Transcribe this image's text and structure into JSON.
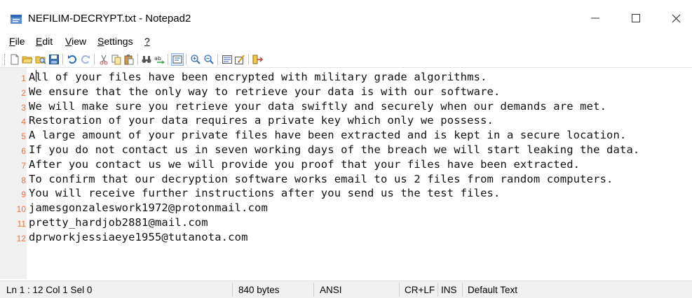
{
  "window": {
    "title": "NEFILIM-DECRYPT.txt - Notepad2",
    "minimize": "—",
    "maximize": "☐",
    "close": "✕"
  },
  "menu": [
    {
      "acc": "F",
      "rest": "ile"
    },
    {
      "acc": "E",
      "rest": "dit"
    },
    {
      "acc": "V",
      "rest": "iew"
    },
    {
      "acc": "S",
      "rest": "ettings"
    },
    {
      "acc": "?",
      "rest": ""
    }
  ],
  "toolbar": {
    "icons": [
      "new-file-icon",
      "open-file-icon",
      "browse-icon",
      "save-icon",
      "undo-icon",
      "redo-icon",
      "cut-icon",
      "copy-icon",
      "paste-icon",
      "find-icon",
      "replace-icon",
      "word-wrap-icon",
      "zoom-in-icon",
      "zoom-out-icon",
      "select-scheme-icon",
      "customize-scheme-icon",
      "exit-icon"
    ]
  },
  "editor": {
    "lines": [
      {
        "num": "1",
        "text": "All of your files have been encrypted with military grade algorithms."
      },
      {
        "num": "2",
        "text": "We ensure that the only way to retrieve your data is with our software."
      },
      {
        "num": "3",
        "text": "We will make sure you retrieve your data swiftly and securely when our demands are met."
      },
      {
        "num": "4",
        "text": "Restoration of your data requires a private key which only we possess."
      },
      {
        "num": "5",
        "text": "A large amount of your private files have been extracted and is kept in a secure location."
      },
      {
        "num": "6",
        "text": "If you do not contact us in seven working days of the breach we will start leaking the data."
      },
      {
        "num": "7",
        "text": "After you contact us we will provide you proof that your files have been extracted."
      },
      {
        "num": "8",
        "text": "To confirm that our decryption software works email to us 2 files from random computers."
      },
      {
        "num": "9",
        "text": "You will receive further instructions after you send us the test files."
      },
      {
        "num": "10",
        "text": "jamesgonzaleswork1972@protonmail.com"
      },
      {
        "num": "11",
        "text": "pretty_hardjob2881@mail.com"
      },
      {
        "num": "12",
        "text": "dprworkjessiaeye1955@tutanota.com"
      }
    ]
  },
  "status": {
    "position": "Ln 1 : 12   Col 1   Sel 0",
    "size": "840 bytes",
    "encoding": "ANSI",
    "eol": "CR+LF",
    "mode": "INS",
    "scheme": "Default Text"
  },
  "colors": {
    "line_number": "#ff6e2e",
    "gutter": "#f0f0f0",
    "statusbar": "#f0f0f0"
  }
}
